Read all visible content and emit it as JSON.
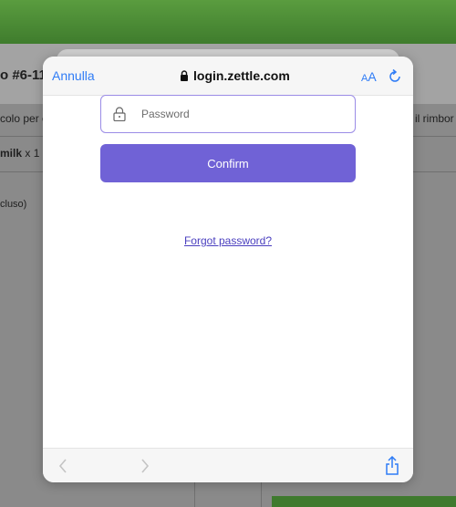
{
  "background": {
    "order_title": "o #6-11",
    "line1_left": "colo per e",
    "line1_right": "il rimbor",
    "item_name": "milk",
    "item_qty": "x 1",
    "tax_note": "cluso)"
  },
  "browser": {
    "cancel_label": "Annulla",
    "url": "login.zettle.com",
    "text_size_small": "A",
    "text_size_big": "A"
  },
  "login": {
    "password_placeholder": "Password",
    "confirm_label": "Confirm",
    "forgot_label": "Forgot password?"
  },
  "colors": {
    "accent": "#7062d6",
    "link": "#2f7cf6",
    "app_green": "#4a8c36"
  }
}
